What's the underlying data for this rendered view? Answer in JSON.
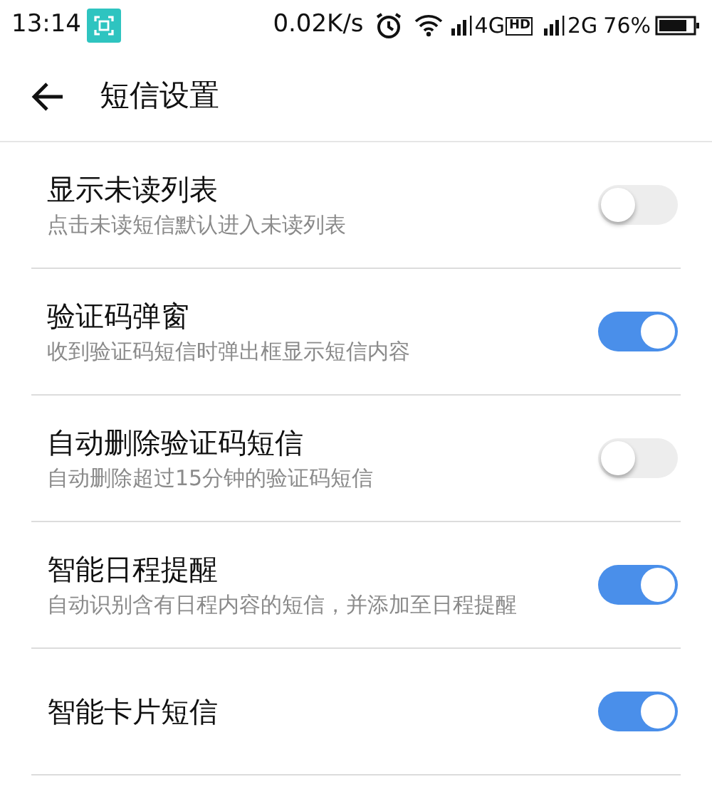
{
  "status_bar": {
    "time": "13:14",
    "speed": "0.02K/s",
    "network_1": "4G",
    "hd_badge": "HD",
    "network_2": "2G",
    "battery": "76%"
  },
  "header": {
    "title": "短信设置"
  },
  "settings": [
    {
      "title": "显示未读列表",
      "subtitle": "点击未读短信默认进入未读列表",
      "on": false
    },
    {
      "title": "验证码弹窗",
      "subtitle": "收到验证码短信时弹出框显示短信内容",
      "on": true
    },
    {
      "title": "自动删除验证码短信",
      "subtitle": "自动删除超过15分钟的验证码短信",
      "on": false
    },
    {
      "title": "智能日程提醒",
      "subtitle": "自动识别含有日程内容的短信，并添加至日程提醒",
      "on": true
    },
    {
      "title": "智能卡片短信",
      "on": true
    }
  ]
}
